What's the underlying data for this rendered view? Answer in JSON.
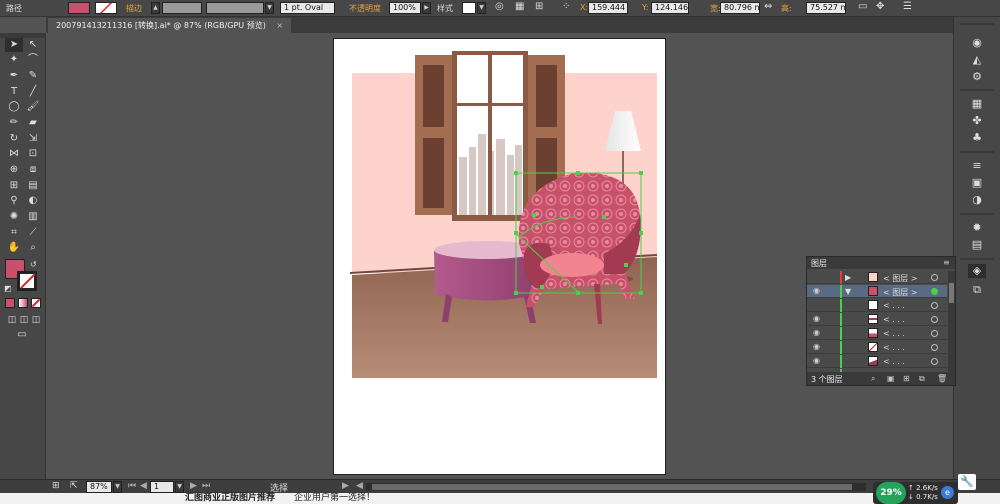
{
  "control_bar": {
    "path_label": "路径",
    "stroke_label": "描边",
    "stroke_value": "",
    "brush_value": "1 pt. Oval",
    "opacity_label": "不透明度",
    "opacity_value": "100%",
    "style_label": "样式",
    "x_label": "X:",
    "x_value": "159.444",
    "y_label": "Y:",
    "y_value": "124.146",
    "w_label": "宽:",
    "w_value": "80.796 mm",
    "h_label": "高:",
    "h_value": "75.527 mm"
  },
  "document_tab": "200791413211316 [转换].ai* @ 87% (RGB/GPU 预览)",
  "layers_panel": {
    "title": "图层",
    "footer": "3 个图层",
    "rows": [
      {
        "name": "< 图层 >",
        "selected": false
      },
      {
        "name": "< 图层 >",
        "selected": true
      },
      {
        "name": "< . . .",
        "selected": false
      },
      {
        "name": "< . . .",
        "selected": false
      },
      {
        "name": "< . . .",
        "selected": false
      },
      {
        "name": "< . . .",
        "selected": false
      },
      {
        "name": "< . . .",
        "selected": false
      },
      {
        "name": "< . . .",
        "selected": false
      }
    ]
  },
  "status_bar": {
    "zoom": "87%",
    "artboard_num": "1",
    "tool_name": "选择"
  },
  "ad_strip": {
    "headline": "汇图商业正版图片推荐",
    "sub": "企业用户第一选择！"
  },
  "net_widget": {
    "percent": "29%",
    "up": "2.6K/s",
    "down": "0.7K/s"
  },
  "colors": {
    "ui_bg": "#535353",
    "panel": "#474747",
    "selection_green": "#4ccf4c",
    "wall_pink": "#fdd3cb",
    "floor": "#a87c66",
    "chair": "#c65169"
  }
}
